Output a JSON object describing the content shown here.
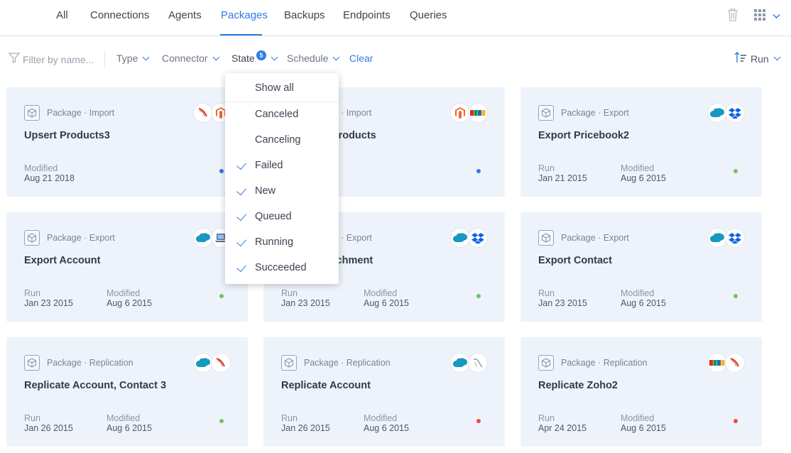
{
  "nav": {
    "tabs": [
      {
        "label": "All"
      },
      {
        "label": "Connections"
      },
      {
        "label": "Agents"
      },
      {
        "label": "Packages",
        "active": true
      },
      {
        "label": "Backups"
      },
      {
        "label": "Endpoints"
      },
      {
        "label": "Queries"
      }
    ],
    "icons": [
      "trash-icon",
      "apps-grid-icon",
      "chevron-down-icon"
    ]
  },
  "filters": {
    "search_placeholder": "Filter by name...",
    "type_label": "Type",
    "connector_label": "Connector",
    "state_label": "State",
    "state_count": "5",
    "schedule_label": "Schedule",
    "clear_label": "Clear",
    "sort_label": "Run"
  },
  "state_dropdown": {
    "show_all": "Show all",
    "options": [
      {
        "label": "Canceled",
        "checked": false
      },
      {
        "label": "Canceling",
        "checked": false
      },
      {
        "label": "Failed",
        "checked": true
      },
      {
        "label": "New",
        "checked": true
      },
      {
        "label": "Queued",
        "checked": true
      },
      {
        "label": "Running",
        "checked": true
      },
      {
        "label": "Succeeded",
        "checked": true
      }
    ]
  },
  "colors": {
    "accent": "#2f7be5",
    "card_bg": "#eef3fb",
    "status_blue": "#2f7be5",
    "status_green": "#72c35c",
    "status_red": "#e8503a"
  },
  "cards": [
    {
      "type": "Package · Import",
      "title": "Upsert Products3",
      "run_label": "",
      "run": "",
      "modified_label": "Modified",
      "modified": "Aug 21 2018",
      "status": "blue",
      "logos": [
        "sql-server-icon",
        "magento-icon"
      ]
    },
    {
      "type": "Package · Import",
      "title": "Products, Products",
      "run_label": "",
      "run": "",
      "modified_label": "",
      "modified": "",
      "status": "blue",
      "logos": [
        "magento-icon",
        "zoho-icon"
      ]
    },
    {
      "type": "Package · Export",
      "title": "Export Pricebook2",
      "run_label": "Run",
      "run": "Jan 21 2015",
      "modified_label": "Modified",
      "modified": "Aug 6 2015",
      "status": "green",
      "logos": [
        "salesforce-icon",
        "dropbox-icon"
      ]
    },
    {
      "type": "Package · Export",
      "title": "Export Account",
      "run_label": "Run",
      "run": "Jan 23 2015",
      "modified_label": "Modified",
      "modified": "Aug 6 2015",
      "status": "green",
      "logos": [
        "salesforce-icon",
        "laptop-icon"
      ]
    },
    {
      "type": "Package · Export",
      "title": "Export Attachment",
      "run_label": "Run",
      "run": "Jan 23 2015",
      "modified_label": "Modified",
      "modified": "Aug 6 2015",
      "status": "green",
      "logos": [
        "salesforce-icon",
        "dropbox-icon"
      ]
    },
    {
      "type": "Package · Export",
      "title": "Export Contact",
      "run_label": "Run",
      "run": "Jan 23 2015",
      "modified_label": "Modified",
      "modified": "Aug 6 2015",
      "status": "green",
      "logos": [
        "salesforce-icon",
        "dropbox-icon"
      ]
    },
    {
      "type": "Package · Replication",
      "title": "Replicate Account, Contact 3",
      "run_label": "Run",
      "run": "Jan 26 2015",
      "modified_label": "Modified",
      "modified": "Aug 6 2015",
      "status": "green",
      "logos": [
        "salesforce-icon",
        "sql-server-icon"
      ]
    },
    {
      "type": "Package · Replication",
      "title": "Replicate Account",
      "run_label": "Run",
      "run": "Jan 26 2015",
      "modified_label": "Modified",
      "modified": "Aug 6 2015",
      "status": "red",
      "logos": [
        "salesforce-icon",
        "mysql-icon"
      ]
    },
    {
      "type": "Package · Replication",
      "title": "Replicate Zoho2",
      "run_label": "Run",
      "run": "Apr 24 2015",
      "modified_label": "Modified",
      "modified": "Aug 6 2015",
      "status": "red",
      "logos": [
        "zoho-icon",
        "sql-server-icon"
      ]
    }
  ]
}
